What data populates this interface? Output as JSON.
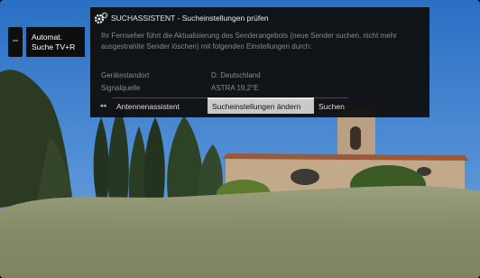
{
  "side_menu": {
    "line1": "Automat.",
    "line2": "Suche TV+R"
  },
  "dialog": {
    "icon": "gear-icon",
    "title": "SUCHASSISTENT - Sucheinstellungen prüfen",
    "message": "Ihr Fernseher führt die Aktualisierung des Senderangebots (neue Sender suchen, nicht mehr ausgestrahlte Sender löschen) mit folgenden Einstellungen durch:",
    "settings": [
      {
        "label": "Gerätestandort",
        "value": "D: Deutschland"
      },
      {
        "label": "Signalquelle",
        "value": "ASTRA 19,2°E"
      }
    ]
  },
  "buttons": {
    "back_icon": "rewind-icon",
    "back_glyph": "◂◂",
    "antenna": "Antennenassistent",
    "change_settings": "Sucheinstellungen ändern",
    "search": "Suchen"
  },
  "colors": {
    "dialog_bg": "#0e0e0e",
    "selected_button": "#c9c9c9",
    "sky": "#2f78c8"
  }
}
